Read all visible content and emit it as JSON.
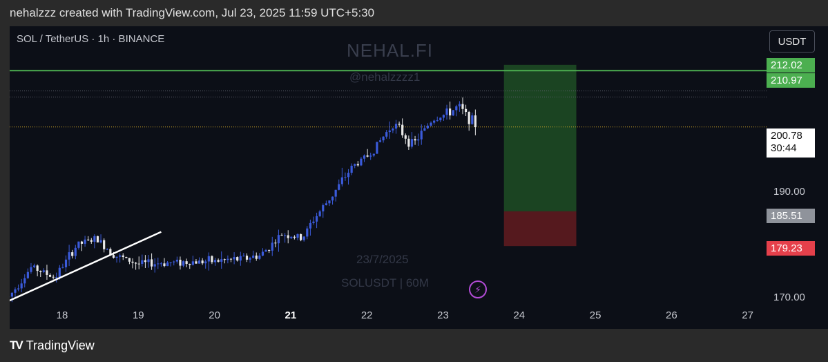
{
  "header": {
    "caption": "nehalzzz created with TradingView.com, Jul 23, 2025 11:59 UTC+5:30"
  },
  "chart": {
    "symbol_title": "SOL / TetherUS · 1h · BINANCE",
    "watermark_main": "NEHAL.FI",
    "watermark_handle": "@nehalzzzz1",
    "watermark_date": "23/7/2025",
    "watermark_ticker": "SOLUSDT | 60M",
    "currency_button": "USDT",
    "price_labels": {
      "target": "212.02",
      "resistance": "210.97",
      "current": "200.78",
      "countdown": "30:44",
      "entry": "185.51",
      "stop": "179.23"
    },
    "axis_ticks": [
      "190.00",
      "170.00"
    ],
    "date_ticks": [
      {
        "label": "18",
        "bold": false
      },
      {
        "label": "19",
        "bold": false
      },
      {
        "label": "20",
        "bold": false
      },
      {
        "label": "21",
        "bold": true
      },
      {
        "label": "22",
        "bold": false
      },
      {
        "label": "23",
        "bold": false
      },
      {
        "label": "24",
        "bold": false
      },
      {
        "label": "25",
        "bold": false
      },
      {
        "label": "26",
        "bold": false
      },
      {
        "label": "27",
        "bold": false
      }
    ],
    "colors": {
      "bull": "#3b5bdb",
      "bear": "#e8e8e8",
      "resistance_line": "#4caf50",
      "target_zone": "#1f4d25",
      "stop_zone": "#5a1a1f",
      "current_line": "#c9a227"
    }
  },
  "chart_data": {
    "type": "candlestick",
    "title": "SOL / TetherUS · 1h · BINANCE",
    "ylim": [
      168.5,
      215
    ],
    "x_ticks": [
      "18",
      "19",
      "20",
      "21",
      "22",
      "23",
      "24",
      "25",
      "26",
      "27"
    ],
    "y_ticks": [
      190,
      170
    ],
    "resistance_level": 210.97,
    "current_price": 200.78,
    "position": {
      "entry": 185.51,
      "target": 212.02,
      "stop": 179.23,
      "start_day": 23.8,
      "end_day": 24.75
    },
    "trendline": {
      "from": {
        "day": 17.3,
        "price": 169.3
      },
      "to": {
        "day": 19.3,
        "price": 181.8
      }
    },
    "key_closes": [
      {
        "day": 17.3,
        "price": 170.0
      },
      {
        "day": 17.6,
        "price": 175.5
      },
      {
        "day": 17.9,
        "price": 173.5
      },
      {
        "day": 18.2,
        "price": 179.5
      },
      {
        "day": 18.45,
        "price": 180.5
      },
      {
        "day": 18.7,
        "price": 177.5
      },
      {
        "day": 19.0,
        "price": 176.0
      },
      {
        "day": 19.5,
        "price": 176.3
      },
      {
        "day": 20.0,
        "price": 176.5
      },
      {
        "day": 20.3,
        "price": 176.8
      },
      {
        "day": 20.6,
        "price": 177.5
      },
      {
        "day": 20.9,
        "price": 181.5
      },
      {
        "day": 21.15,
        "price": 180.5
      },
      {
        "day": 21.3,
        "price": 184.0
      },
      {
        "day": 21.55,
        "price": 188.5
      },
      {
        "day": 21.8,
        "price": 193.5
      },
      {
        "day": 22.05,
        "price": 196.0
      },
      {
        "day": 22.35,
        "price": 201.5
      },
      {
        "day": 22.6,
        "price": 197.5
      },
      {
        "day": 22.85,
        "price": 202.0
      },
      {
        "day": 23.1,
        "price": 203.5
      },
      {
        "day": 23.2,
        "price": 204.5
      },
      {
        "day": 23.45,
        "price": 200.8
      }
    ]
  }
}
